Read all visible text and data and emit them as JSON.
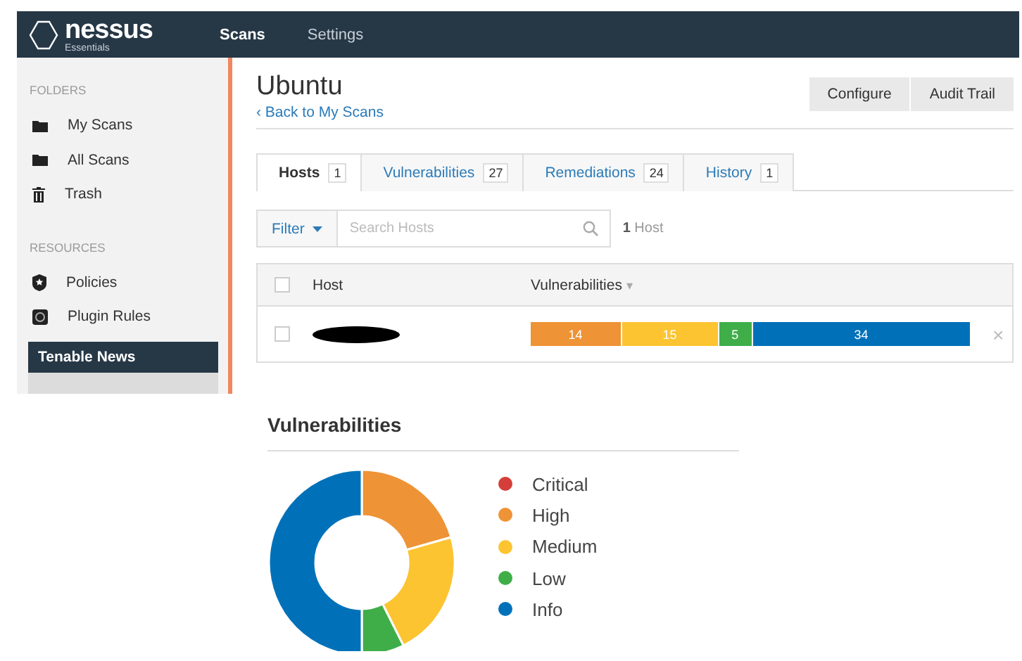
{
  "header": {
    "logo": {
      "name": "nessus",
      "edition": "Essentials"
    },
    "nav": [
      {
        "label": "Scans",
        "selected": true
      },
      {
        "label": "Settings",
        "selected": false
      }
    ]
  },
  "sidebar": {
    "sections": [
      {
        "title": "FOLDERS",
        "items": [
          {
            "label": "My Scans",
            "kind": "folder"
          },
          {
            "label": "All Scans",
            "kind": "folder"
          },
          {
            "label": "Trash",
            "kind": "trash"
          }
        ]
      },
      {
        "title": "RESOURCES",
        "items": [
          {
            "label": "Policies",
            "kind": "shield"
          },
          {
            "label": "Plugin Rules",
            "kind": "plugin"
          }
        ]
      }
    ],
    "news": {
      "title": "Tenable News"
    }
  },
  "scan": {
    "title": "Ubuntu",
    "back_link": "‹ Back to My Scans",
    "buttons": [
      "Configure",
      "Audit Trail"
    ]
  },
  "tabs": [
    {
      "label": "Hosts",
      "count": "1",
      "selected": true
    },
    {
      "label": "Vulnerabilities",
      "count": "27",
      "selected": false
    },
    {
      "label": "Remediations",
      "count": "24",
      "selected": false
    },
    {
      "label": "History",
      "count": "1",
      "selected": false
    }
  ],
  "filter": {
    "button": "Filter",
    "placeholder": "Search Hosts",
    "result": "**1** Host"
  },
  "table": {
    "select_all_checked": false,
    "columns": [
      {
        "label": "Host"
      },
      {
        "label": "Vulnerabilities",
        "sort": "▾"
      }
    ],
    "rows": [
      {
        "checked": false,
        "host_redacted": true,
        "remove": "×",
        "segments": [
          {
            "value": "14",
            "color": "#ee9336"
          },
          {
            "value": "15",
            "color": "#fdc431"
          },
          {
            "value": "5",
            "color": "#3fae49"
          },
          {
            "value": "34",
            "color": "#0071b9"
          }
        ]
      }
    ]
  },
  "chart": {
    "title": "Vulnerabilities",
    "legend": [
      {
        "color": "#d43f3a"
      },
      {
        "color": "#ee9336"
      },
      {
        "color": "#fdc431"
      },
      {
        "color": "#3fae49"
      },
      {
        "color": "#0071b9"
      }
    ],
    "chart_data": {
      "type": "donut",
      "categories": [
        "Critical",
        "High",
        "Medium",
        "Low",
        "Info"
      ],
      "values": [
        0,
        20.6,
        22.0,
        7.4,
        50.0
      ]
    }
  }
}
